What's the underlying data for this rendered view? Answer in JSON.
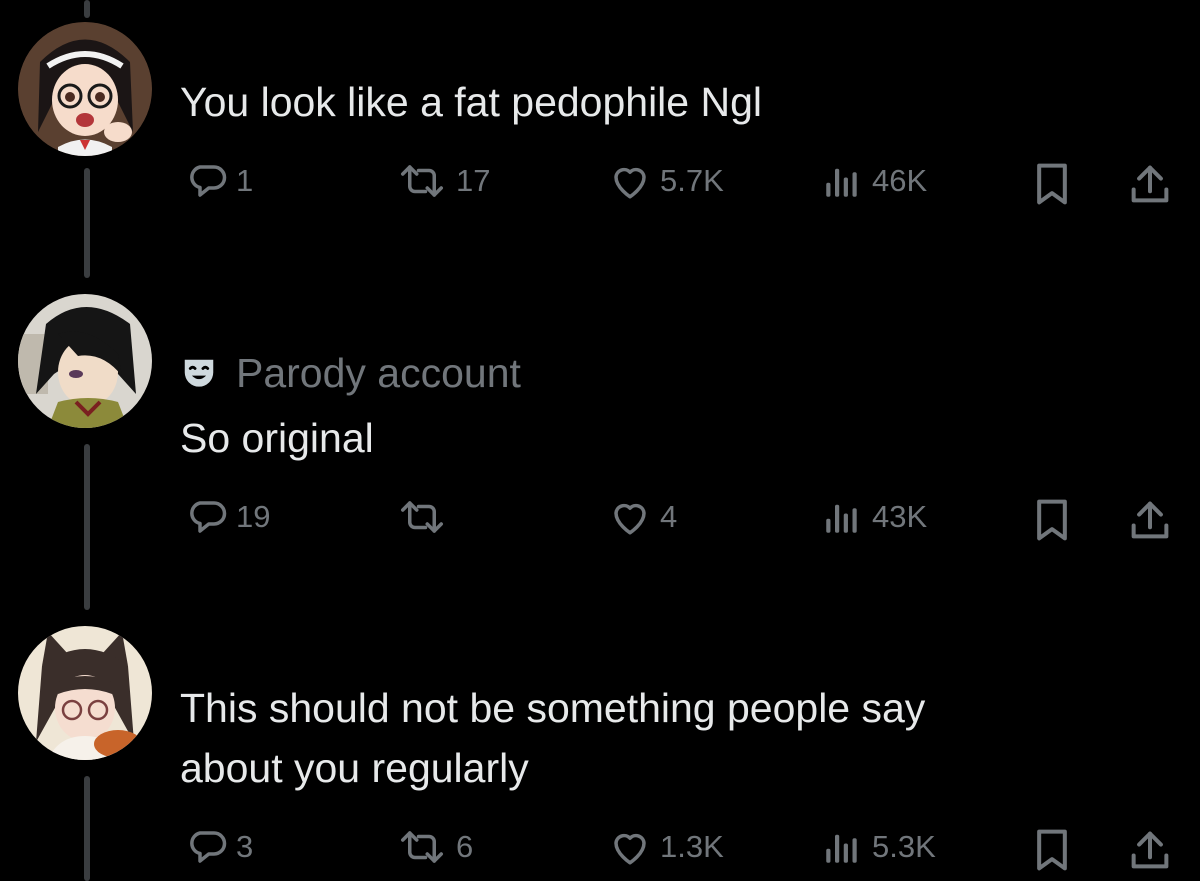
{
  "replies": [
    {
      "text_lines": [
        "You look like a fat pedophile Ngl"
      ],
      "reply_count": "1",
      "repost_count": "17",
      "like_count": "5.7K",
      "view_count": "46K"
    },
    {
      "badge": {
        "label": "Parody account",
        "icon": "theater-mask-icon"
      },
      "text_lines": [
        "So original"
      ],
      "reply_count": "19",
      "repost_count": "",
      "like_count": "4",
      "view_count": "43K"
    },
    {
      "text_lines": [
        "This should not be something people say",
        "about you regularly"
      ],
      "reply_count": "3",
      "repost_count": "6",
      "like_count": "1.3K",
      "view_count": "5.3K"
    }
  ],
  "icons": {
    "reply": "reply-bubble-icon",
    "repost": "repost-arrows-icon",
    "like": "heart-icon",
    "views": "views-bar-chart-icon",
    "bookmark": "bookmark-icon",
    "share": "share-icon"
  },
  "colors": {
    "background": "#000000",
    "text": "#e7e9ea",
    "muted": "#71767b",
    "parody_badge": "#cfd9de"
  }
}
